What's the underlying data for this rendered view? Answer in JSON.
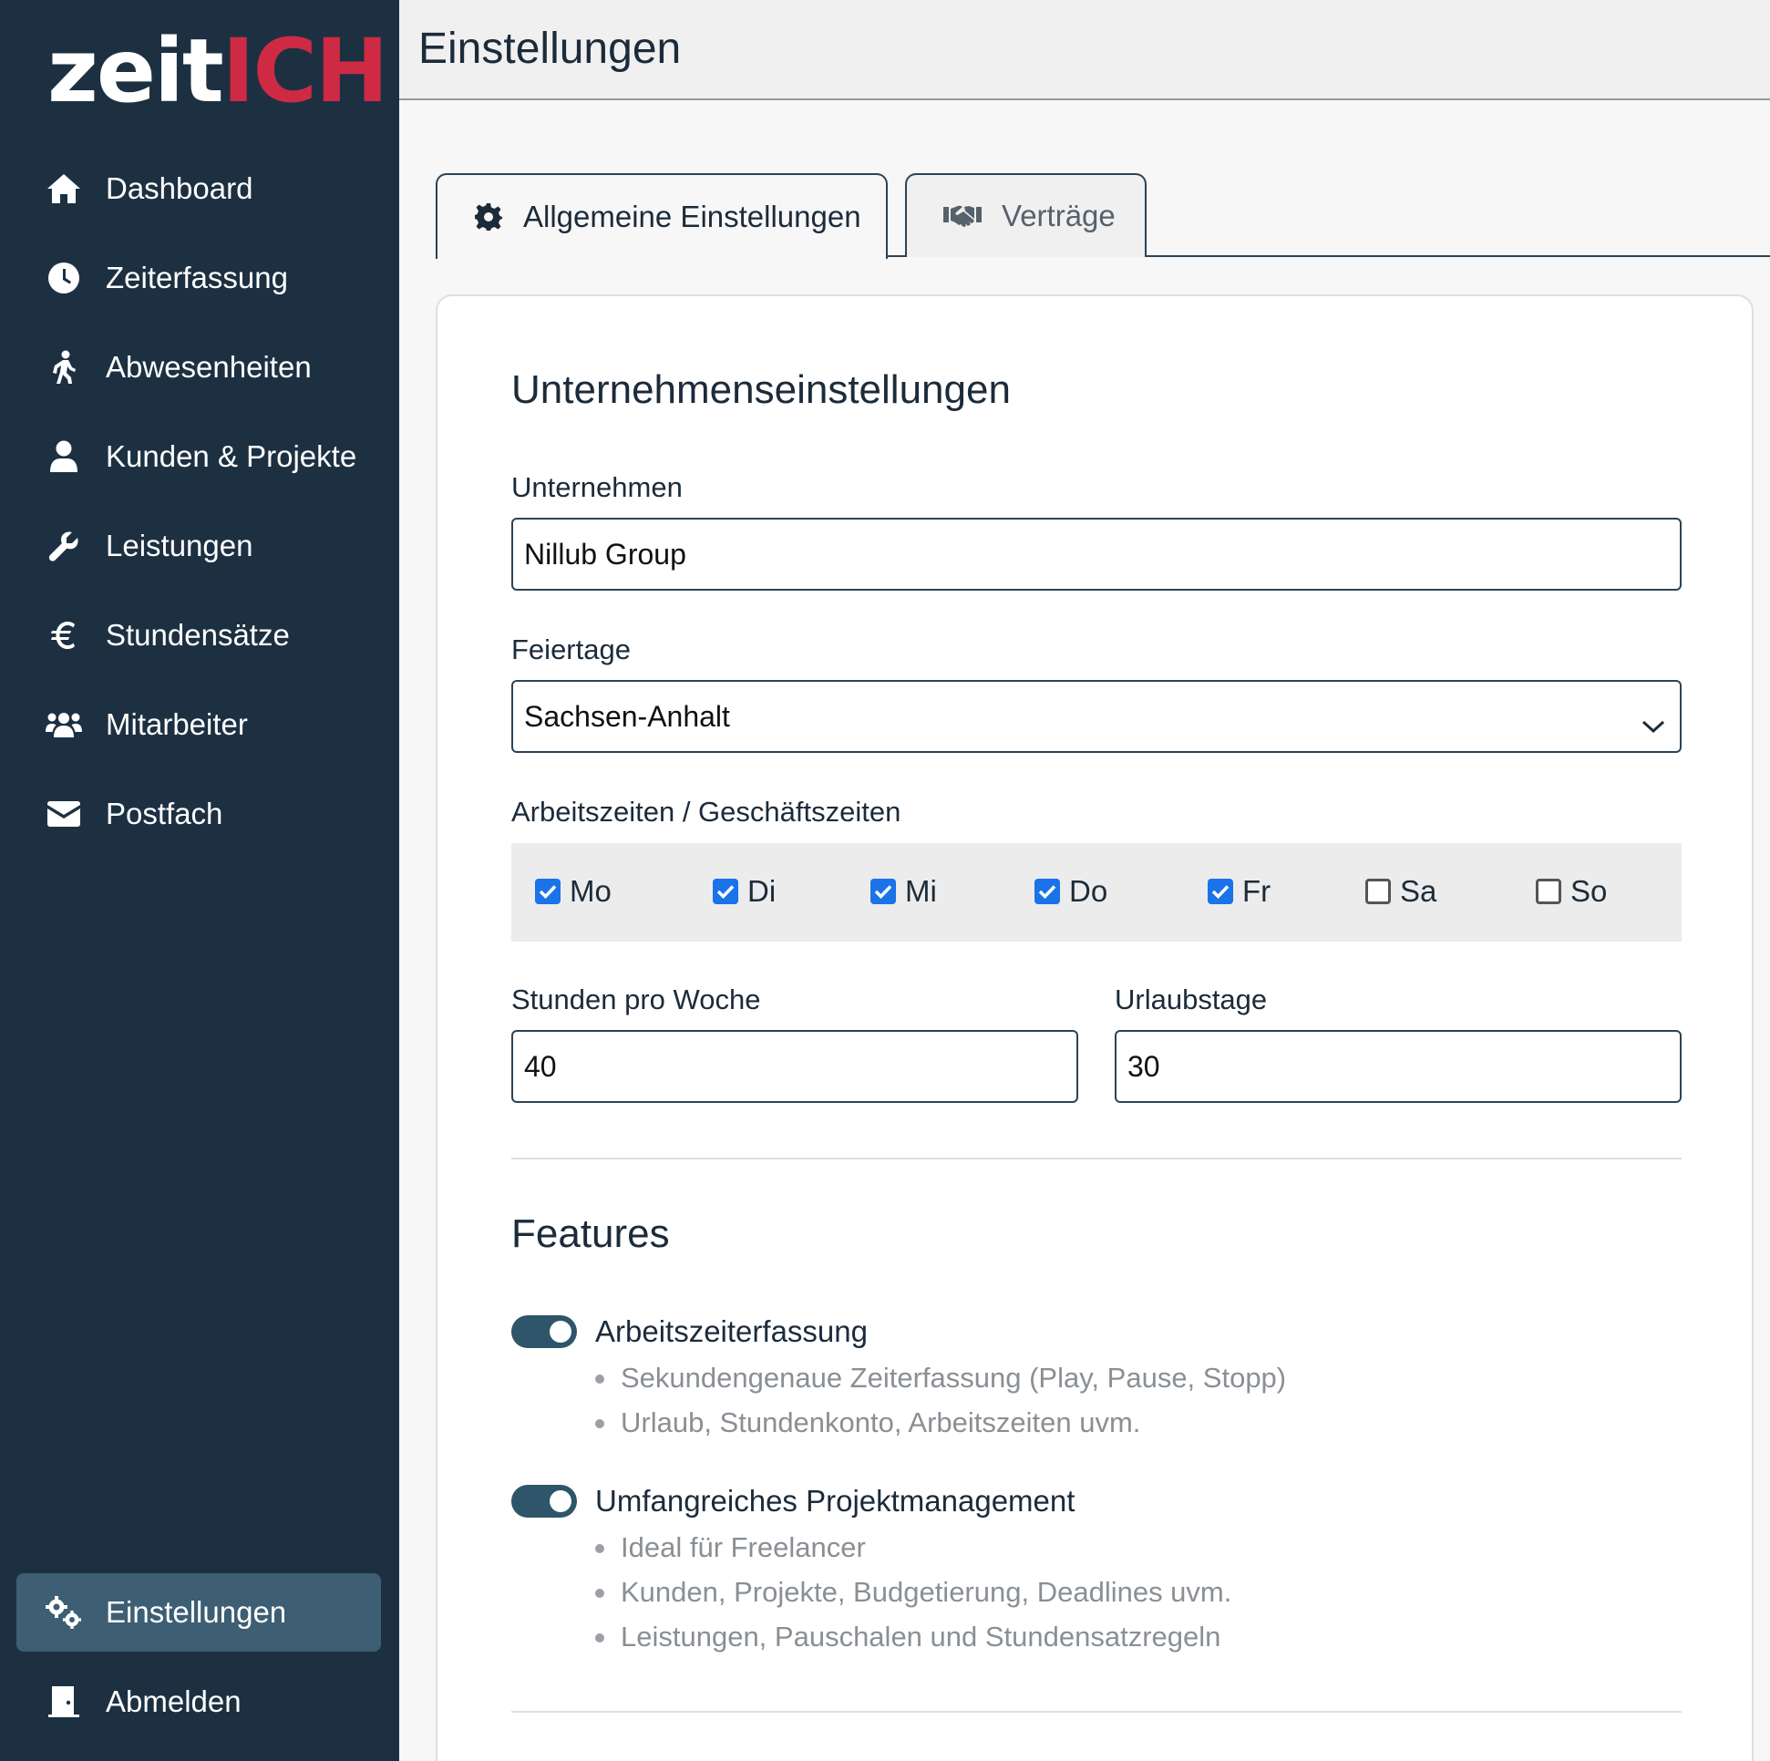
{
  "logo": {
    "part1": "zeit",
    "part2": "ICH"
  },
  "nav": {
    "items": [
      {
        "label": "Dashboard",
        "icon": "home-icon"
      },
      {
        "label": "Zeiterfassung",
        "icon": "clock-icon"
      },
      {
        "label": "Abwesenheiten",
        "icon": "walking-icon"
      },
      {
        "label": "Kunden & Projekte",
        "icon": "user-icon"
      },
      {
        "label": "Leistungen",
        "icon": "wrench-icon"
      },
      {
        "label": "Stundensätze",
        "icon": "euro-icon"
      },
      {
        "label": "Mitarbeiter",
        "icon": "users-icon"
      },
      {
        "label": "Postfach",
        "icon": "envelope-icon"
      }
    ],
    "settings": {
      "label": "Einstellungen",
      "icon": "cogs-icon",
      "active": true
    },
    "logout": {
      "label": "Abmelden",
      "icon": "door-icon"
    }
  },
  "header": {
    "title": "Einstellungen"
  },
  "tabs": [
    {
      "label": "Allgemeine Einstellungen",
      "icon": "gear-icon",
      "active": true
    },
    {
      "label": "Verträge",
      "icon": "handshake-icon",
      "active": false
    }
  ],
  "company": {
    "title": "Unternehmenseinstellungen",
    "company_label": "Unternehmen",
    "company_value": "Nillub Group",
    "holidays_label": "Feiertage",
    "holidays_value": "Sachsen-Anhalt",
    "workdays_label": "Arbeitszeiten / Geschäftszeiten",
    "days": [
      {
        "label": "Mo",
        "checked": true
      },
      {
        "label": "Di",
        "checked": true
      },
      {
        "label": "Mi",
        "checked": true
      },
      {
        "label": "Do",
        "checked": true
      },
      {
        "label": "Fr",
        "checked": true
      },
      {
        "label": "Sa",
        "checked": false
      },
      {
        "label": "So",
        "checked": false
      }
    ],
    "hours_label": "Stunden pro Woche",
    "hours_value": "40",
    "vacation_label": "Urlaubstage",
    "vacation_value": "30"
  },
  "features": {
    "title": "Features",
    "items": [
      {
        "label": "Arbeitszeiterfassung",
        "enabled": true,
        "bullets": [
          "Sekundengenaue Zeiterfassung (Play, Pause, Stopp)",
          "Urlaub, Stundenkonto, Arbeitszeiten uvm."
        ]
      },
      {
        "label": "Umfangreiches Projektmanagement",
        "enabled": true,
        "bullets": [
          "Ideal für Freelancer",
          "Kunden, Projekte, Budgetierung, Deadlines uvm.",
          "Leistungen, Pauschalen und Stundensatzregeln"
        ]
      }
    ]
  },
  "colors": {
    "sidebar": "#1d3042",
    "active_nav": "#3d5e73",
    "accent_red": "#cf2a44",
    "toggle": "#2e5569",
    "checkbox": "#1a73e8"
  }
}
